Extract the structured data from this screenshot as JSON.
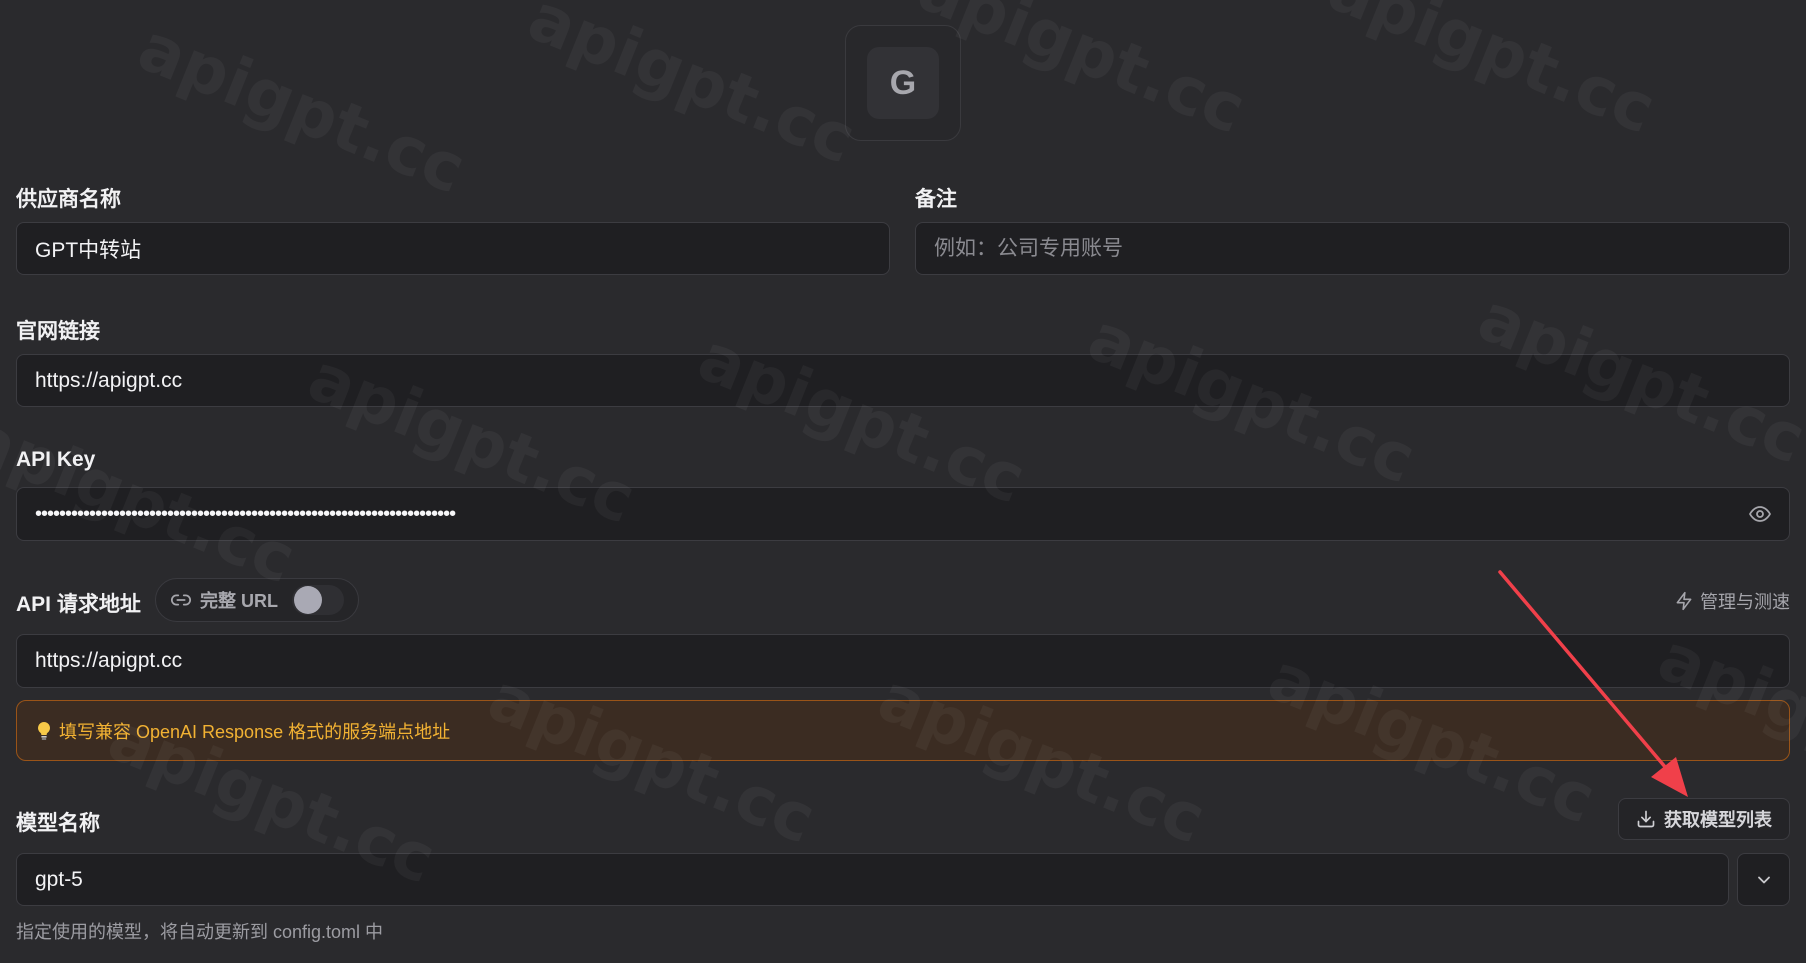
{
  "logo": {
    "letter": "G"
  },
  "provider": {
    "label": "供应商名称",
    "value": "GPT中转站"
  },
  "notes": {
    "label": "备注",
    "placeholder": "例如：公司专用账号"
  },
  "website": {
    "label": "官网链接",
    "value": "https://apigpt.cc"
  },
  "api_key": {
    "label": "API Key",
    "masked_value": "••••••••••••••••••••••••••••••••••••••••••••••••••••••••••••••••••••••",
    "toggle_icon": "eye-icon"
  },
  "endpoint": {
    "label": "API 请求地址",
    "full_url_toggle": {
      "label": "完整 URL",
      "enabled": false,
      "icon": "link-icon"
    },
    "manage_link": {
      "label": "管理与测速",
      "icon": "zap-icon"
    },
    "value": "https://apigpt.cc",
    "hint": {
      "icon": "lightbulb-icon",
      "text": "填写兼容 OpenAI Response 格式的服务端点地址"
    }
  },
  "model": {
    "label": "模型名称",
    "fetch_button": {
      "label": "获取模型列表",
      "icon": "download-icon"
    },
    "value": "gpt-5",
    "dropdown_icon": "chevron-down-icon",
    "help": "指定使用的模型，将自动更新到 config.toml 中"
  },
  "watermark": "apigpt.cc",
  "colors": {
    "background": "#2a2a2d",
    "field_bg": "#1f1f22",
    "hint_border": "#9a5418",
    "hint_text": "#f2b233",
    "annotation_arrow": "#f0404a"
  }
}
